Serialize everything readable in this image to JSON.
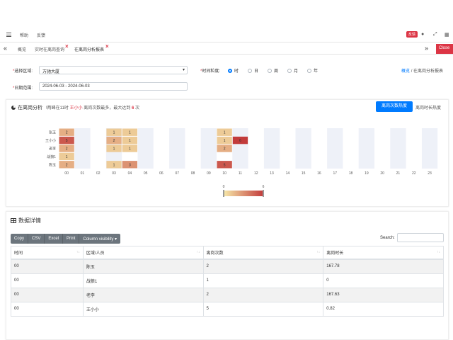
{
  "nav": {
    "links": [
      "帮助",
      "反馈"
    ],
    "badge": "反馈"
  },
  "tabs": {
    "items": [
      {
        "label": "概览",
        "closable": false
      },
      {
        "label": "实时在离岗查询",
        "closable": true
      },
      {
        "label": "在离岗分析报表",
        "closable": true,
        "active": true
      }
    ],
    "close_label": "Close"
  },
  "filters": {
    "area_label": "选择区域:",
    "area_value": "万驰大厦",
    "granularity_label": "时间粒度:",
    "granularity_options": [
      "时",
      "日",
      "周",
      "月",
      "年"
    ],
    "granularity_selected": 0,
    "date_label": "日期范围:",
    "date_value": "2024-06-03 - 2024-06-03"
  },
  "breadcrumb": {
    "home": "概览",
    "sep": "/",
    "current": "在离岗分析报表"
  },
  "panel": {
    "title": "在离岗分析",
    "info_prefix": "!两峰在11时",
    "info_name": "王小小",
    "info_mid": "离岗次数最多，最大达到",
    "info_num": "6",
    "info_suffix": "次",
    "btn_count": "离岗次数热度",
    "btn_duration": "离岗时长热度"
  },
  "chart_data": {
    "type": "heatmap",
    "y_categories": [
      "张玉",
      "王小小",
      "老李",
      "战狼1",
      "陈玉"
    ],
    "x_categories": [
      "00",
      "01",
      "02",
      "03",
      "04",
      "05",
      "06",
      "07",
      "08",
      "09",
      "10",
      "11",
      "12",
      "13",
      "14",
      "15",
      "16",
      "17",
      "18",
      "19",
      "20",
      "21",
      "22",
      "23"
    ],
    "cells": [
      {
        "y": "张玉",
        "x": "00",
        "v": 2
      },
      {
        "y": "张玉",
        "x": "03",
        "v": 1
      },
      {
        "y": "张玉",
        "x": "04",
        "v": 1
      },
      {
        "y": "张玉",
        "x": "10",
        "v": 1
      },
      {
        "y": "王小小",
        "x": "00",
        "v": 5
      },
      {
        "y": "王小小",
        "x": "03",
        "v": 2
      },
      {
        "y": "王小小",
        "x": "04",
        "v": 1
      },
      {
        "y": "王小小",
        "x": "10",
        "v": 1
      },
      {
        "y": "王小小",
        "x": "11",
        "v": 6
      },
      {
        "y": "老李",
        "x": "00",
        "v": 2
      },
      {
        "y": "老李",
        "x": "03",
        "v": 1
      },
      {
        "y": "老李",
        "x": "04",
        "v": 1
      },
      {
        "y": "老李",
        "x": "10",
        "v": 2
      },
      {
        "y": "战狼1",
        "x": "00",
        "v": 1
      },
      {
        "y": "陈玉",
        "x": "00",
        "v": 2
      },
      {
        "y": "陈玉",
        "x": "03",
        "v": 1
      },
      {
        "y": "陈玉",
        "x": "04",
        "v": 3
      },
      {
        "y": "陈玉",
        "x": "10",
        "v": 5
      }
    ],
    "visual_map": {
      "min": 0,
      "max": 6,
      "min_label": "0",
      "max_label": "6"
    },
    "colors": {
      "low": "#f6e8a9",
      "high": "#c23b3b",
      "stripe": "#eef1f8"
    }
  },
  "details": {
    "title": "数据详情",
    "buttons": [
      "Copy",
      "CSV",
      "Excel",
      "Print",
      "Column visibility ▾"
    ],
    "search_label": "Search:",
    "columns": [
      "时间",
      "区域/人员",
      "离岗次数",
      "离岗时长"
    ],
    "rows": [
      [
        "00",
        "陈玉",
        "2",
        "167.78"
      ],
      [
        "00",
        "战狼1",
        "1",
        "0"
      ],
      [
        "00",
        "老李",
        "2",
        "167.63"
      ],
      [
        "00",
        "王小小",
        "5",
        "0.82"
      ]
    ]
  }
}
